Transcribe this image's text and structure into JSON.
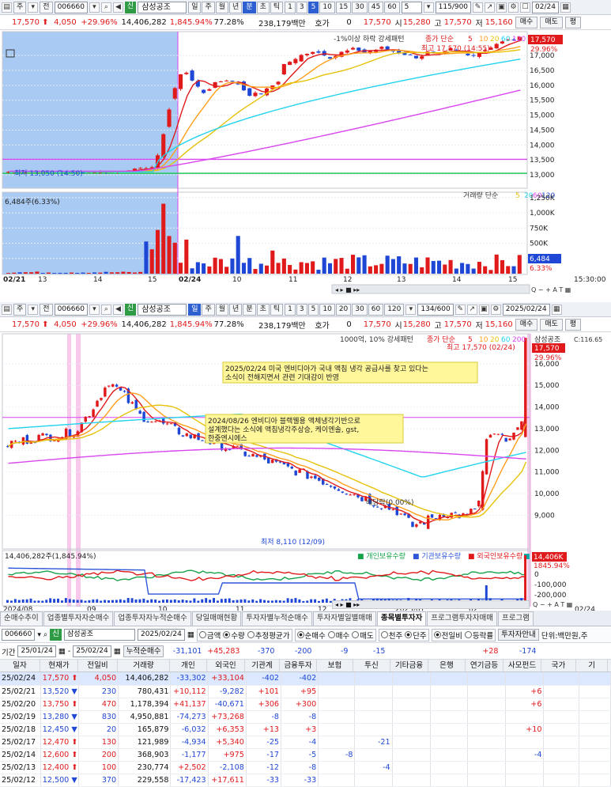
{
  "top_chart": {
    "toolbar": {
      "code": "006660",
      "name": "삼성공조",
      "market": "신",
      "period_buttons": [
        "일",
        "주",
        "월",
        "년",
        "분",
        "초",
        "틱"
      ],
      "selected_period": "분",
      "minute_buttons": [
        "1",
        "3",
        "5",
        "10",
        "15",
        "30",
        "45",
        "60"
      ],
      "selected_minute": "5",
      "interval": "5",
      "count": "115/900",
      "date": "02/24",
      "toggle_labels": [
        "주",
        "전"
      ]
    },
    "quote": {
      "price": "17,570",
      "change": "4,050",
      "change_pct": "+29.96%",
      "volume": "14,406,282",
      "vol_ratio": "1,845.94%",
      "strength": "77.28%",
      "amount": "238,179백만",
      "hoga_label": "호가",
      "hoga": "0",
      "open_label": "시",
      "open": "15,280",
      "high_label": "고",
      "high": "17,570",
      "low_label": "저",
      "low": "15,160",
      "buy": "매수",
      "sell": "매도",
      "eval": "평"
    },
    "legend": {
      "pattern": "-1%이상 하락 강세패턴",
      "ma": "종가 단순",
      "ma_periods": [
        "5",
        "10",
        "20",
        "60",
        "120"
      ],
      "name": "삼성공조"
    },
    "price_axis": [
      "17,000",
      "16,500",
      "16,000",
      "15,500",
      "15,000",
      "14,500",
      "14,000",
      "13,500",
      "13,000"
    ],
    "price_tag": "17,570",
    "price_tag_pct": "29.96%",
    "annotations": {
      "high": "최고 17,570 (14:55)",
      "low": "최저 13,050 (14:50)"
    },
    "volume_label": "6,484주(6.33%)",
    "volume_legend": {
      "label": "거래량",
      "ma": "단순",
      "periods": [
        "5",
        "20",
        "60",
        "120"
      ]
    },
    "volume_axis": [
      "1,250K",
      "1,000K",
      "750K",
      "500K",
      "250K"
    ],
    "volume_tag": "6,484",
    "volume_tag_pct": "6.33%",
    "time_axis": [
      "02/21",
      "13",
      "14",
      "15",
      "02/24",
      "10",
      "11",
      "12",
      "13",
      "14",
      "15",
      "15:30:00"
    ]
  },
  "bottom_chart": {
    "toolbar": {
      "code": "006660",
      "name": "삼성공조",
      "market": "신",
      "period_buttons": [
        "일",
        "주",
        "월",
        "년",
        "분",
        "초",
        "틱"
      ],
      "selected_period": "일",
      "minute_buttons": [
        "1",
        "3",
        "5",
        "10",
        "20",
        "30",
        "60",
        "120"
      ],
      "count": "134/600",
      "date": "2025/02/24",
      "toggle_labels": [
        "주",
        "전"
      ]
    },
    "quote": {
      "price": "17,570",
      "change": "4,050",
      "change_pct": "+29.96%",
      "volume": "14,406,282",
      "vol_ratio": "1,845.94%",
      "strength": "77.28%",
      "amount": "238,179백만",
      "hoga_label": "호가",
      "hoga": "0",
      "open_label": "시",
      "open": "15,280",
      "high_label": "고",
      "high": "17,570",
      "low_label": "저",
      "low": "15,160",
      "buy": "매수",
      "sell": "매도",
      "eval": "평"
    },
    "legend": {
      "pattern": "1000억, 10% 강세패턴",
      "ma": "종가 단순",
      "ma_periods": [
        "5",
        "10",
        "20",
        "60",
        "200"
      ],
      "name": "삼성공조"
    },
    "price_axis": [
      "16,000",
      "15,000",
      "14,000",
      "13,000",
      "12,000",
      "11,000",
      "10,000",
      "9,000"
    ],
    "price_tag": "17,570",
    "price_tag_pct": "29.96%",
    "top_tag": "C:116.65",
    "news1": [
      "2025/02/24  미국 엔비디아가 국내 액침 냉각 공급사를 찾고 있다는",
      "소식이 전해지면서 관련 기대감이 반영"
    ],
    "news2": [
      "2024/08/26 엔비디아 블랙웰용 액체냉각기반으로",
      "설계했다는 소식에 액침냉각주상승,  케이엔솔, gst,",
      "한중엔시에스"
    ],
    "annotations": {
      "high": "최고 17,570 (02/24)",
      "low": "최저 8,110 (12/09)",
      "dividend": "배당락(0.00%)"
    },
    "investor_legend": {
      "volume_label": "14,406,282주(1,845.94%)",
      "individual": "개인보유수량",
      "institution": "기관보유수량",
      "foreign": "외국인보유수량",
      "volume": "거래량"
    },
    "investor_axis": [
      "0",
      "-100,000",
      "-200,000"
    ],
    "investor_tag": "14,406K",
    "investor_tag_pct": "1845.94%",
    "time_axis": [
      "2024/08",
      "09",
      "10",
      "11",
      "12",
      "2025/01",
      "02",
      "02/24"
    ]
  },
  "tabs": [
    "순매수추이",
    "업종별투자자순매수",
    "업종투자자누적순매수",
    "당일매매현황",
    "투자자별누적순매수",
    "투자자별일별매매",
    "종목별투자자",
    "프로그램투자자매매",
    "프로그램"
  ],
  "active_tab": "종목별투자자",
  "controls": {
    "code": "006660",
    "market": "신",
    "name": "삼성공조",
    "date": "2025/02/24",
    "radio1": [
      "금액",
      "수량",
      "추정평균가"
    ],
    "radio1_sel": "수량",
    "radio2": [
      "순매수",
      "매수",
      "매도"
    ],
    "radio2_sel": "순매수",
    "radio3": [
      "천주",
      "단주"
    ],
    "radio3_sel": "단주",
    "radio4": [
      "전일비",
      "등락률"
    ],
    "radio4_sel": "전일비",
    "btn": "투자자안내",
    "unit": "단위:백만원,주"
  },
  "period": {
    "label": "기간",
    "from": "25/01/24",
    "to": "25/02/24",
    "cum_label": "누적순매수",
    "sums": [
      "-31,101",
      "+45,283",
      "-370",
      "-200",
      "-9",
      "-15",
      "",
      "",
      "+28",
      "-174"
    ]
  },
  "table": {
    "headers": [
      "일자",
      "현재가",
      "전일비",
      "거래량",
      "개인",
      "외국인",
      "기관계",
      "금융투자",
      "보험",
      "투신",
      "기타금융",
      "은행",
      "연기금등",
      "사모펀드",
      "국가",
      "기"
    ],
    "rows": [
      [
        "25/02/24",
        "17,570",
        "4,050",
        "14,406,282",
        "-33,302",
        "+33,104",
        "-402",
        "-402",
        "",
        "",
        "",
        "",
        "",
        "",
        "",
        ""
      ],
      [
        "25/02/21",
        "13,520",
        "230",
        "780,431",
        "+10,112",
        "-9,282",
        "+101",
        "+95",
        "",
        "",
        "",
        "",
        "",
        "+6",
        "",
        ""
      ],
      [
        "25/02/20",
        "13,750",
        "470",
        "1,178,394",
        "+41,137",
        "-40,671",
        "+306",
        "+300",
        "",
        "",
        "",
        "",
        "",
        "+6",
        "",
        ""
      ],
      [
        "25/02/19",
        "13,280",
        "830",
        "4,950,881",
        "-74,273",
        "+73,268",
        "-8",
        "-8",
        "",
        "",
        "",
        "",
        "",
        "",
        "",
        ""
      ],
      [
        "25/02/18",
        "12,450",
        "20",
        "165,879",
        "-6,032",
        "+6,353",
        "+13",
        "+3",
        "",
        "",
        "",
        "",
        "",
        "+10",
        "",
        ""
      ],
      [
        "25/02/17",
        "12,470",
        "130",
        "121,989",
        "-4,934",
        "+5,340",
        "-25",
        "-4",
        "",
        "-21",
        "",
        "",
        "",
        "",
        "",
        ""
      ],
      [
        "25/02/14",
        "12,600",
        "200",
        "368,903",
        "-1,177",
        "+975",
        "-17",
        "-5",
        "-8",
        "",
        "",
        "",
        "",
        "-4",
        "",
        ""
      ],
      [
        "25/02/13",
        "12,400",
        "100",
        "230,774",
        "+2,502",
        "-2,108",
        "-12",
        "-8",
        "",
        "-4",
        "",
        "",
        "",
        "",
        "",
        ""
      ],
      [
        "25/02/12",
        "12,500",
        "370",
        "229,558",
        "-17,423",
        "+17,611",
        "-33",
        "-33",
        "",
        "",
        "",
        "",
        "",
        "",
        "",
        ""
      ]
    ],
    "dirs": [
      "up",
      "down",
      "up",
      "down",
      "down",
      "up",
      "up",
      "up",
      "down"
    ]
  },
  "colors": {
    "up": "#e0191b",
    "down": "#1f47d6",
    "ma5": "#e0191b",
    "ma10": "#ff9e1b",
    "ma20": "#e8c20a",
    "ma60": "#22d3ee",
    "ma120": "#d946ef",
    "individual": "#16a34a",
    "foreign": "#e0191b",
    "institution": "#2f56d8"
  }
}
